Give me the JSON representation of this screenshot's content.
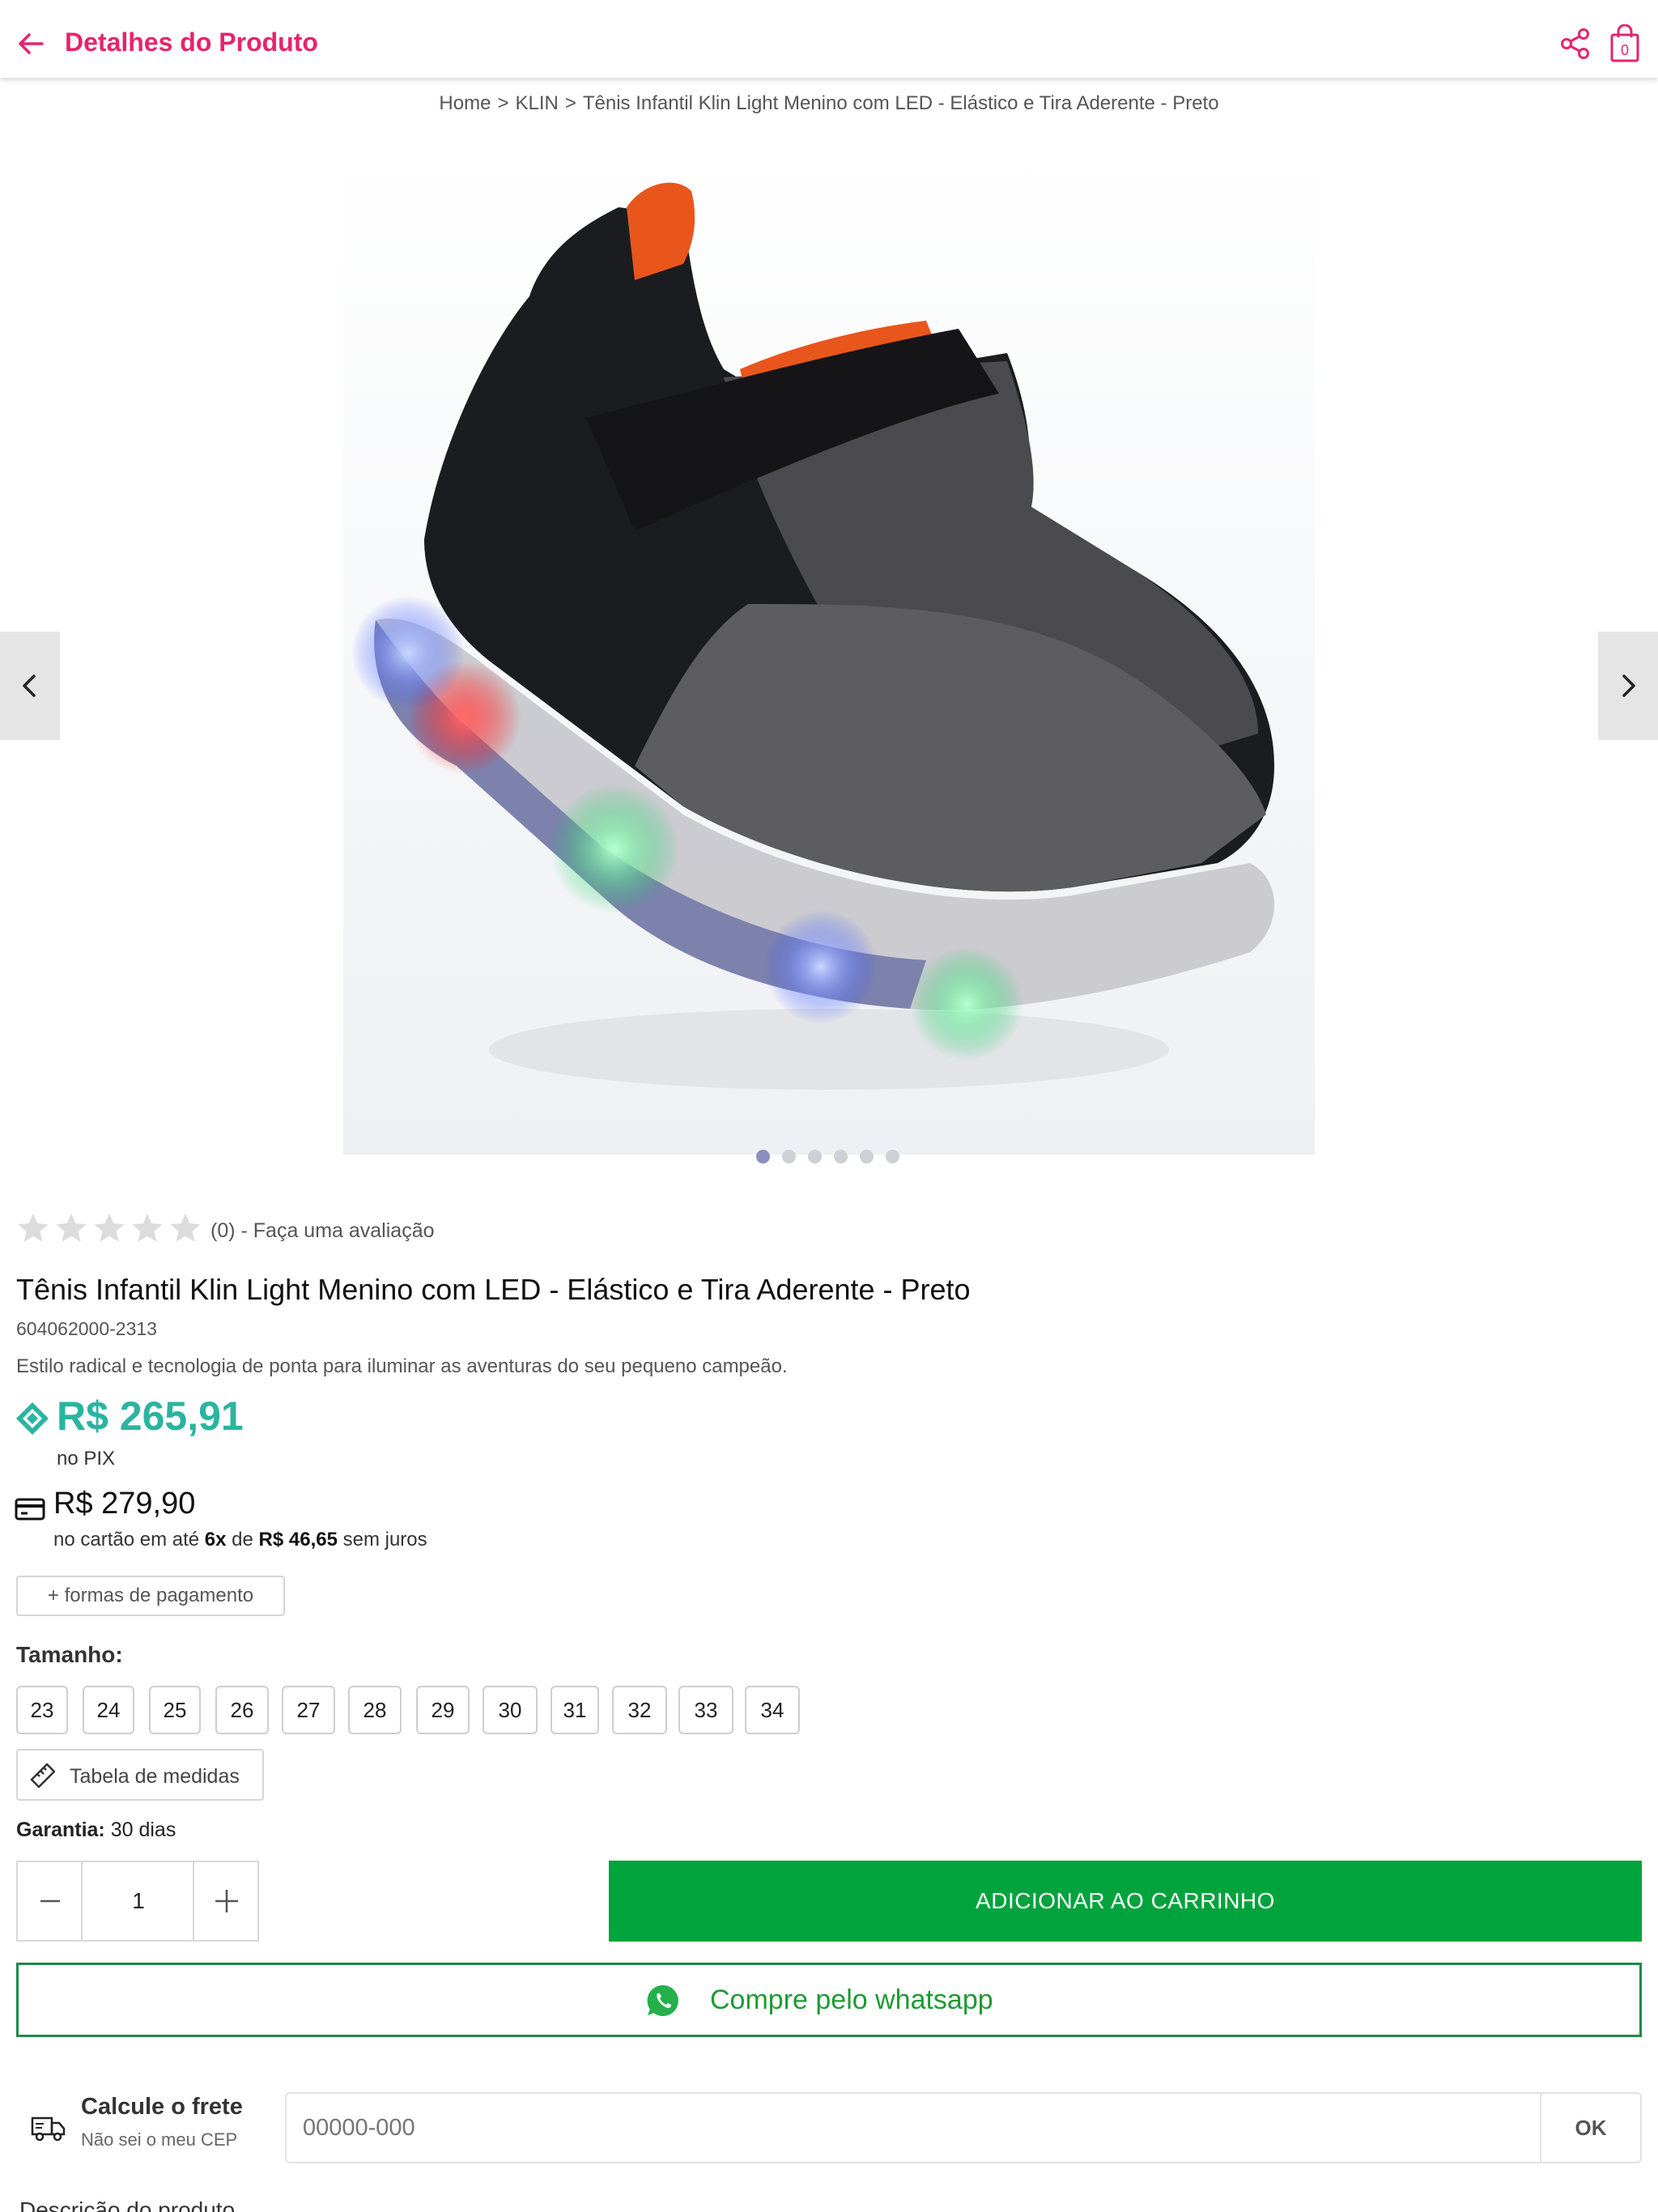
{
  "header": {
    "title": "Detalhes do Produto",
    "brand_color": "#e6246c"
  },
  "breadcrumb": {
    "home": "Home",
    "sep": ">",
    "brand": "KLIN",
    "product": "Tênis Infantil Klin Light Menino com LED - Elástico e Tira Aderente - Preto"
  },
  "gallery": {
    "slides_count": 6,
    "active_index": 0
  },
  "rating": {
    "stars_filled": 0,
    "stars_total": 5,
    "text": "(0) - Faça uma avaliação"
  },
  "product": {
    "name": "Tênis Infantil Klin Light Menino com LED - Elástico e Tira Aderente - Preto",
    "sku": "604062000-2313",
    "description": "Estilo radical e tecnologia de ponta para iluminar as aventuras do seu pequeno campeão."
  },
  "price": {
    "pix_value": "R$ 265,91",
    "pix_label": "no PIX",
    "pix_color": "#2bb4a0",
    "card_value": "R$ 279,90",
    "card_prefix": "no cartão em até",
    "card_installments": "6x",
    "card_of": "de",
    "card_installment_value": "R$ 46,65",
    "card_suffix": "sem juros",
    "payment_methods_label": "+ formas de pagamento"
  },
  "size": {
    "label": "Tamanho:",
    "options": [
      "23",
      "24",
      "25",
      "26",
      "27",
      "28",
      "29",
      "30",
      "31",
      "32",
      "33",
      "34"
    ],
    "measure_label": "Tabela de medidas"
  },
  "warranty": {
    "label": "Garantia:",
    "value": "30 dias"
  },
  "cart": {
    "quantity": "1",
    "add_label": "ADICIONAR AO CARRINHO",
    "add_color": "#00a33c"
  },
  "whatsapp": {
    "label": "Compre pelo whatsapp"
  },
  "shipping": {
    "title": "Calcule o frete",
    "subtitle": "Não sei o meu CEP",
    "placeholder": "00000-000",
    "ok_label": "OK"
  },
  "description_section": {
    "title": "Descrição do produto"
  }
}
